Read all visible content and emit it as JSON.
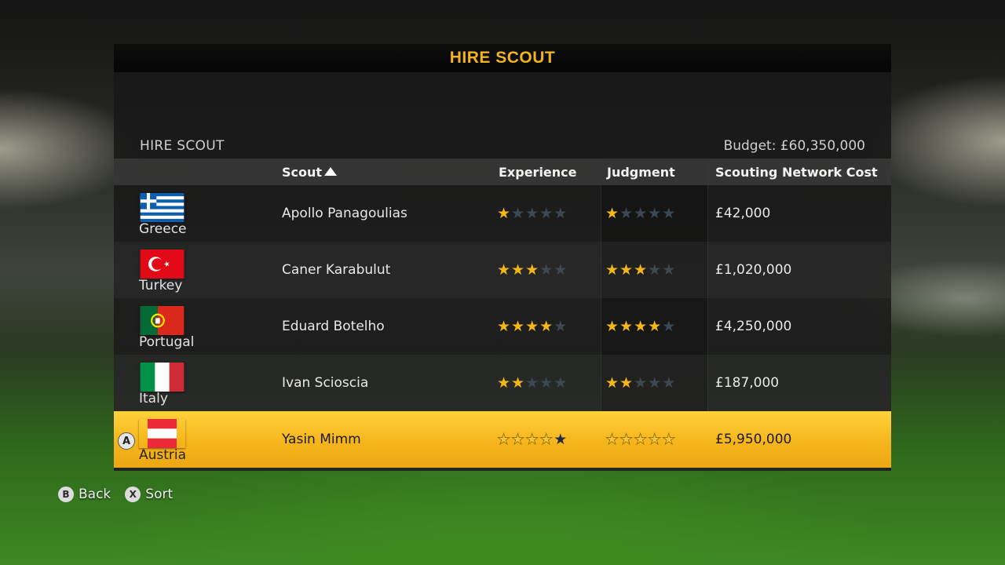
{
  "header": {
    "title": "HIRE SCOUT"
  },
  "panel": {
    "section_title": "HIRE SCOUT",
    "budget": "Budget: £60,350,000"
  },
  "columns": {
    "scout": "Scout",
    "experience": "Experience",
    "judgment": "Judgment",
    "cost": "Scouting Network Cost"
  },
  "max_stars": 5,
  "rows": [
    {
      "country": "Greece",
      "flag": "greece-flag",
      "name": "Apollo Panagoulias",
      "experience": 1,
      "judgment": 1,
      "cost": "£42,000",
      "selected": false
    },
    {
      "country": "Turkey",
      "flag": "turkey-flag",
      "name": "Caner Karabulut",
      "experience": 3,
      "judgment": 3,
      "cost": "£1,020,000",
      "selected": false
    },
    {
      "country": "Portugal",
      "flag": "portugal-flag",
      "name": "Eduard Botelho",
      "experience": 4,
      "judgment": 4,
      "cost": "£4,250,000",
      "selected": false
    },
    {
      "country": "Italy",
      "flag": "italy-flag",
      "name": "Ivan Scioscia",
      "experience": 2,
      "judgment": 2,
      "cost": "£187,000",
      "selected": false
    },
    {
      "country": "Austria",
      "flag": "austria-flag",
      "name": "Yasin Mimm",
      "experience": 4,
      "judgment": 5,
      "cost": "£5,950,000",
      "selected": true
    }
  ],
  "select_button": "A",
  "footer": {
    "back": {
      "glyph": "B",
      "label": "Back"
    },
    "sort": {
      "glyph": "X",
      "label": "Sort"
    }
  },
  "colors": {
    "accent": "#f0b51d",
    "star_on": "#f3b71c",
    "star_off": "#3e4852"
  }
}
